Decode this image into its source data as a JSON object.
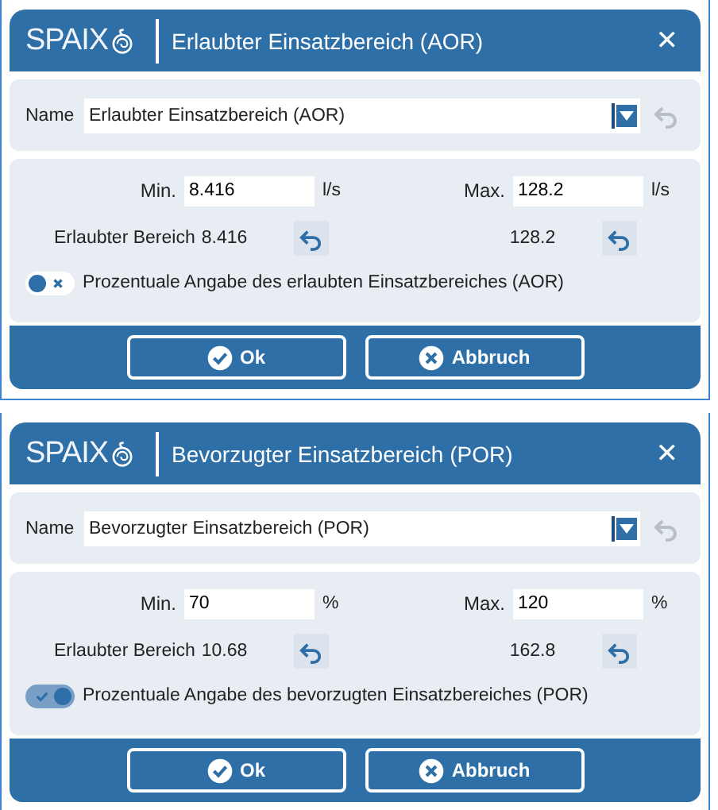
{
  "dialogs": [
    {
      "logo": "SPAIX",
      "title": "Erlaubter Einsatzbereich (AOR)",
      "close": "✕",
      "name": {
        "label": "Name",
        "value": "Erlaubter Einsatzbereich (AOR)"
      },
      "limits": [
        {
          "label": "Min.",
          "value": "8.416",
          "unit": "l/s"
        },
        {
          "label": "Max.",
          "value": "128.2",
          "unit": "l/s"
        }
      ],
      "allowed": {
        "label": "Erlaubter Bereich",
        "values": [
          "8.416",
          "128.2"
        ]
      },
      "percent_toggle": {
        "on": false,
        "label": "Prozentuale Angabe des erlaubten Einsatzbereiches (AOR)"
      },
      "buttons": [
        {
          "label": "Ok",
          "kind": "ok"
        },
        {
          "label": "Abbruch",
          "kind": "cancel"
        }
      ]
    },
    {
      "logo": "SPAIX",
      "title": "Bevorzugter Einsatzbereich (POR)",
      "close": "✕",
      "name": {
        "label": "Name",
        "value": "Bevorzugter Einsatzbereich (POR)"
      },
      "limits": [
        {
          "label": "Min.",
          "value": "70",
          "unit": "%"
        },
        {
          "label": "Max.",
          "value": "120",
          "unit": "%"
        }
      ],
      "allowed": {
        "label": "Erlaubter Bereich",
        "values": [
          "10.68",
          "162.8"
        ]
      },
      "percent_toggle": {
        "on": true,
        "label": "Prozentuale Angabe des bevorzugten Einsatzbereiches (POR)"
      },
      "buttons": [
        {
          "label": "Ok",
          "kind": "ok"
        },
        {
          "label": "Abbruch",
          "kind": "cancel"
        }
      ]
    }
  ]
}
